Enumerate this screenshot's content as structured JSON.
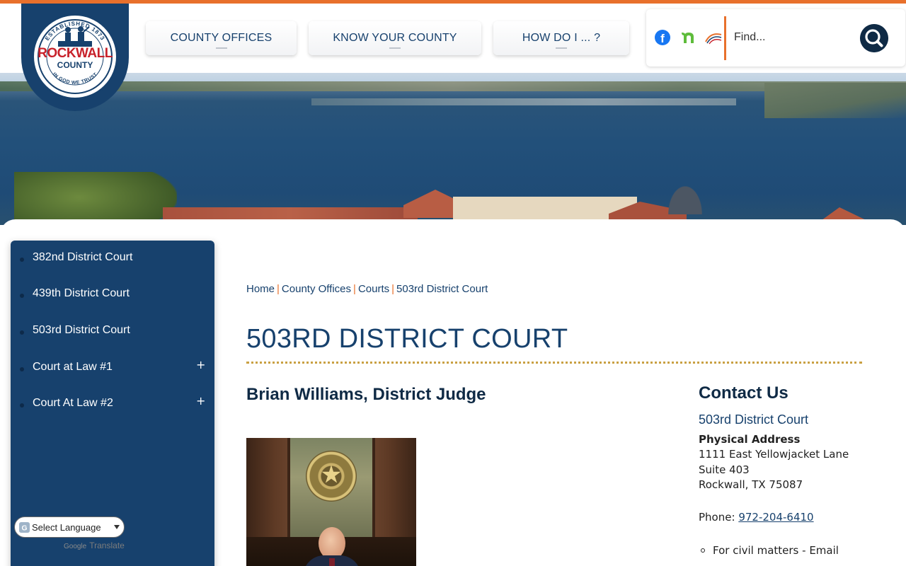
{
  "header": {
    "logo": {
      "ring_text_top": "ESTABLISHED 1873",
      "ring_text_bottom": "IN GOD WE TRUST",
      "name": "ROCKWALL",
      "sub": "COUNTY"
    },
    "nav": [
      {
        "label": "COUNTY OFFICES"
      },
      {
        "label": "KNOW YOUR COUNTY"
      },
      {
        "label": "HOW DO I ... ?"
      }
    ],
    "social": {
      "facebook_letter": "f"
    },
    "search": {
      "placeholder": "Find..."
    }
  },
  "sidebar": {
    "items": [
      {
        "label": "382nd District Court",
        "expandable": false
      },
      {
        "label": "439th District Court",
        "expandable": false
      },
      {
        "label": "503rd District Court",
        "expandable": false
      },
      {
        "label": "Court at Law #1",
        "expandable": true,
        "expand_glyph": "+"
      },
      {
        "label": "Court At Law #2",
        "expandable": true,
        "expand_glyph": "+"
      }
    ]
  },
  "translate": {
    "label": "Select Language",
    "powered_google": "Google",
    "powered_translate": "Translate"
  },
  "breadcrumb": {
    "items": [
      "Home",
      "County Offices",
      "Courts",
      "503rd District Court"
    ],
    "separator": "|"
  },
  "main": {
    "title": "503RD DISTRICT COURT",
    "judge_heading": "Brian Williams, District Judge"
  },
  "contact": {
    "title": "Contact Us",
    "org": "503rd District Court",
    "address_label": "Physical Address",
    "address_lines": [
      "1111 East Yellowjacket Lane",
      "Suite 403",
      "Rockwall, TX 75087"
    ],
    "phone_label": "Phone:",
    "phone_number": "972-204-6410",
    "bullet_text": "For civil matters - Email"
  },
  "colors": {
    "brand_navy": "#17416d",
    "accent_orange": "#e8702c",
    "rule_gold": "#c9a042"
  }
}
